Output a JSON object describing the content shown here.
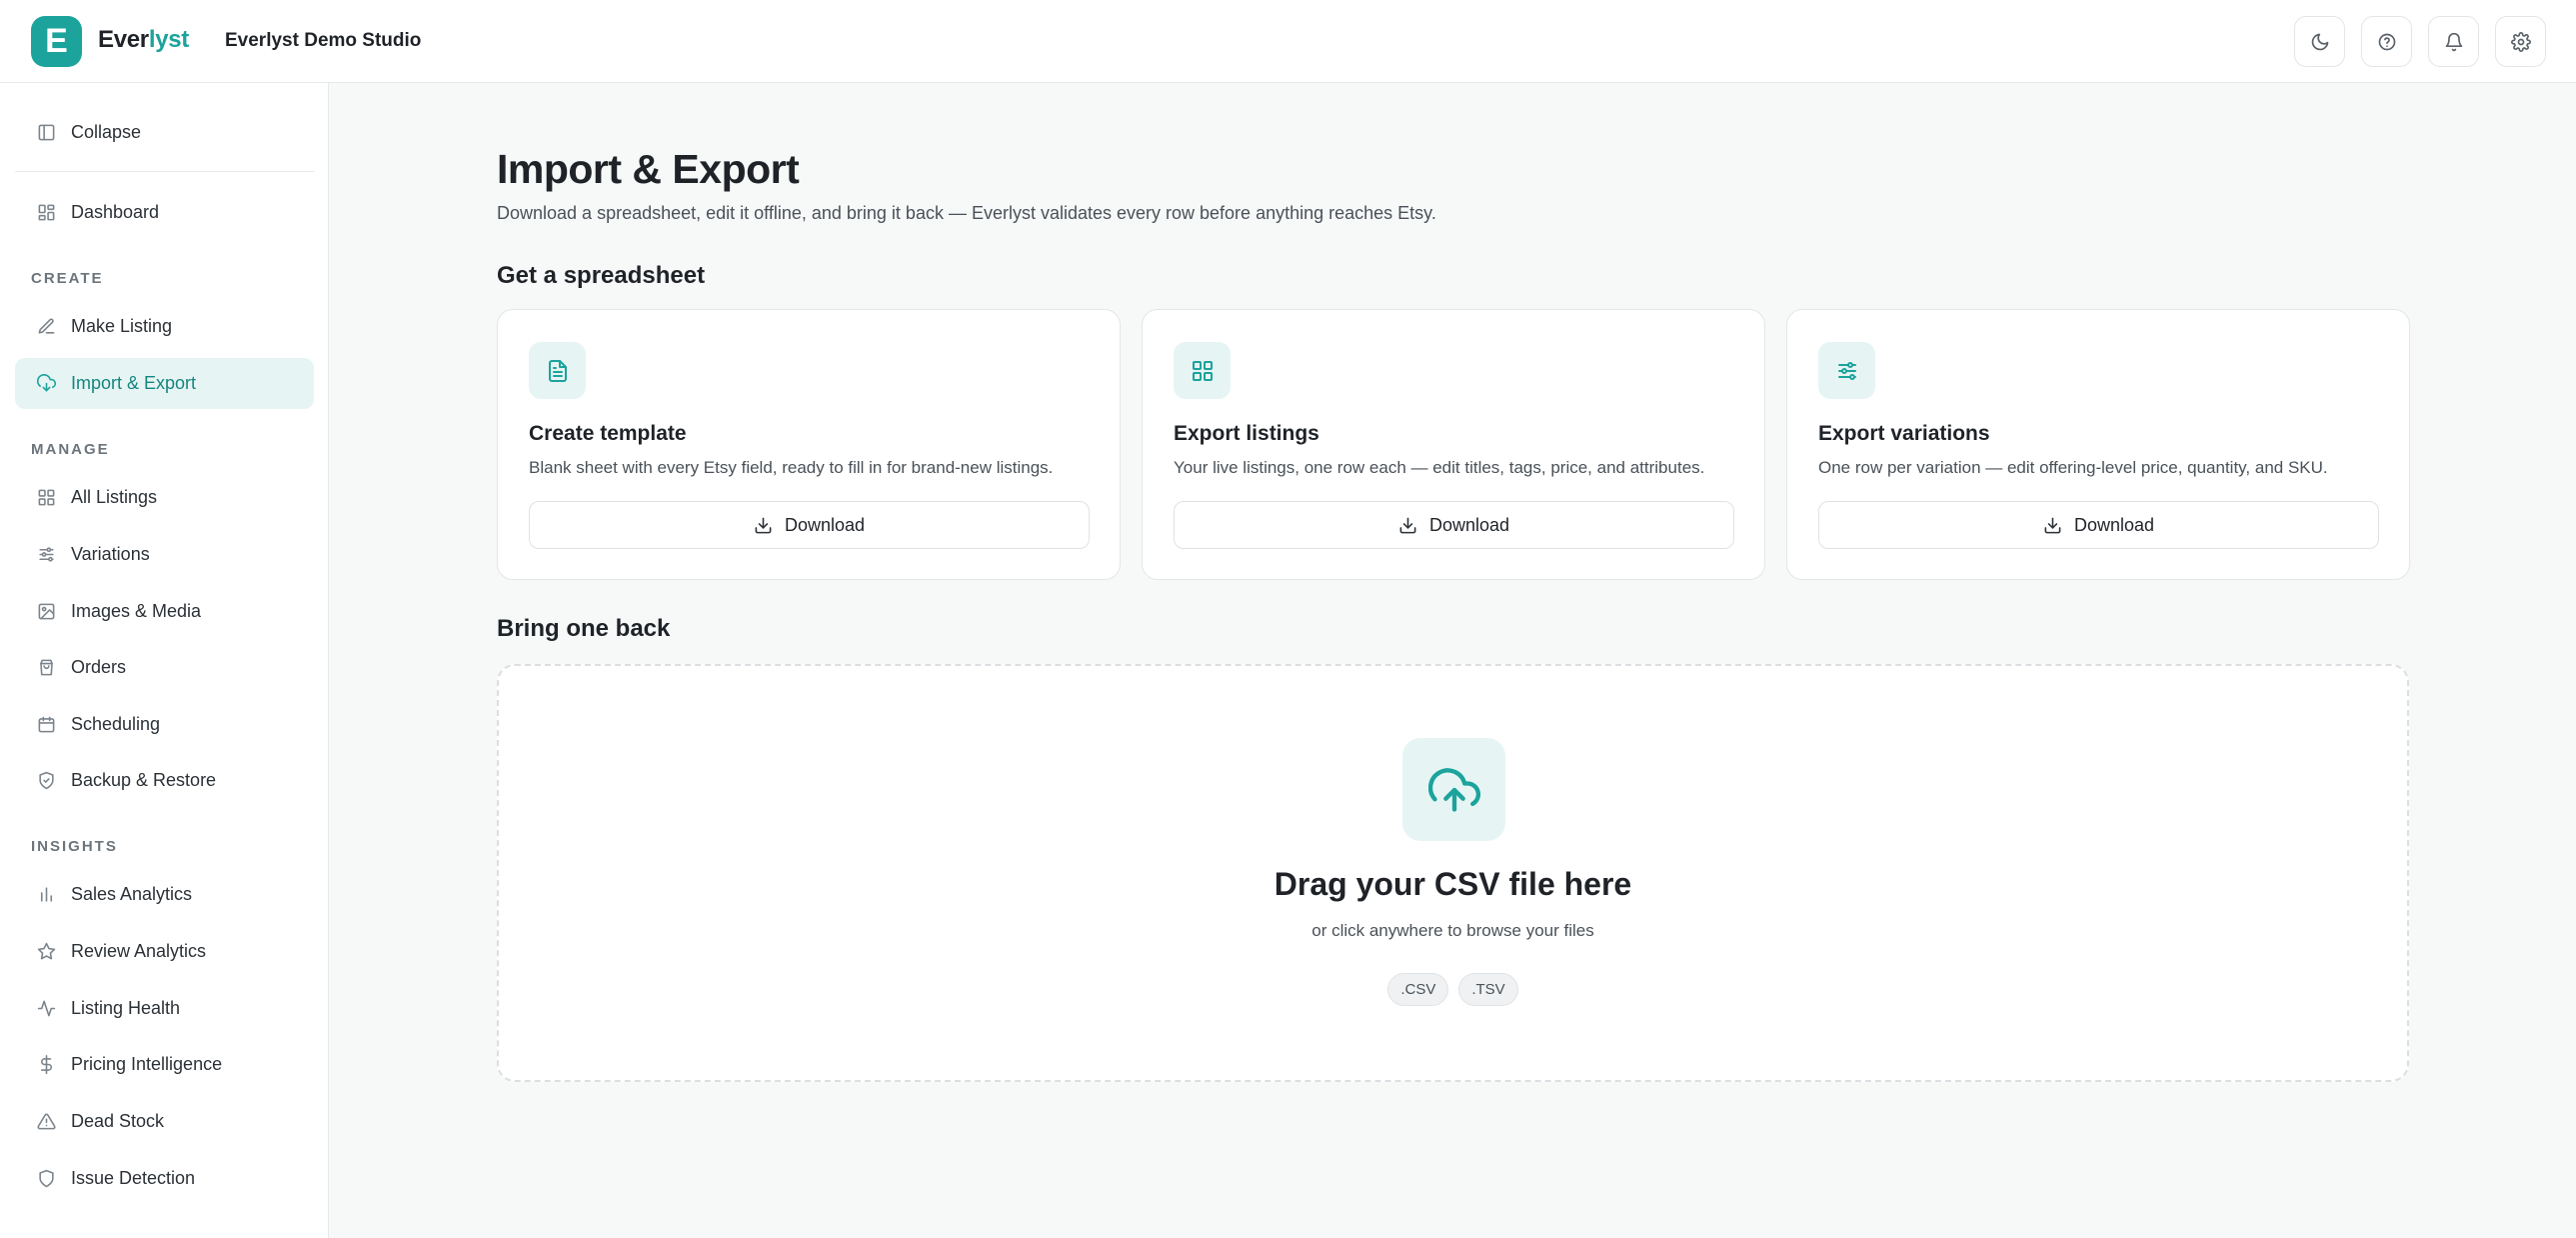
{
  "brand": {
    "logo_letter": "E",
    "name_part1": "Ever",
    "name_part2": "lyst",
    "accent_color": "#1ba39c",
    "org_name": "Everlyst Demo Studio"
  },
  "header": {
    "actions": [
      {
        "icon": "moon-icon"
      },
      {
        "icon": "help-icon"
      },
      {
        "icon": "bell-icon"
      },
      {
        "icon": "gear-icon"
      }
    ]
  },
  "sidebar": {
    "collapse_label": "Collapse",
    "dashboard_label": "Dashboard",
    "sections": {
      "create": "CREATE",
      "manage": "MANAGE",
      "insights": "INSIGHTS"
    },
    "create_items": [
      {
        "label": "Make Listing",
        "icon": "edit-icon"
      },
      {
        "label": "Import & Export",
        "icon": "cloud-sync-icon",
        "active": true
      }
    ],
    "manage_items": [
      {
        "label": "All Listings",
        "icon": "grid-icon"
      },
      {
        "label": "Variations",
        "icon": "sliders-icon"
      },
      {
        "label": "Images & Media",
        "icon": "image-icon"
      },
      {
        "label": "Orders",
        "icon": "bag-icon"
      },
      {
        "label": "Scheduling",
        "icon": "calendar-icon"
      },
      {
        "label": "Backup & Restore",
        "icon": "shield-check-icon"
      }
    ],
    "insights_items": [
      {
        "label": "Sales Analytics",
        "icon": "bar-chart-icon"
      },
      {
        "label": "Review Analytics",
        "icon": "star-icon"
      },
      {
        "label": "Listing Health",
        "icon": "activity-icon"
      },
      {
        "label": "Pricing Intelligence",
        "icon": "dollar-icon"
      },
      {
        "label": "Dead Stock",
        "icon": "warning-icon"
      },
      {
        "label": "Issue Detection",
        "icon": "shield-icon"
      }
    ]
  },
  "main": {
    "title": "Import & Export",
    "subtitle": "Download a spreadsheet, edit it offline, and bring it back — Everlyst validates every row before anything reaches Etsy.",
    "get_section_title": "Get a spreadsheet",
    "cards": [
      {
        "icon": "document-icon",
        "title": "Create template",
        "description": "Blank sheet with every Etsy field, ready to fill in for brand-new listings.",
        "button_label": "Download"
      },
      {
        "icon": "grid-icon",
        "title": "Export listings",
        "description": "Your live listings, one row each — edit titles, tags, price, and attributes.",
        "button_label": "Download"
      },
      {
        "icon": "sliders-icon",
        "title": "Export variations",
        "description": "One row per variation — edit offering-level price, quantity, and SKU.",
        "button_label": "Download"
      }
    ],
    "bring_section_title": "Bring one back",
    "dropzone": {
      "icon": "cloud-upload-icon",
      "title": "Drag your CSV file here",
      "subtitle": "or click anywhere to browse your files",
      "formats": [
        ".CSV",
        ".TSV"
      ]
    }
  }
}
